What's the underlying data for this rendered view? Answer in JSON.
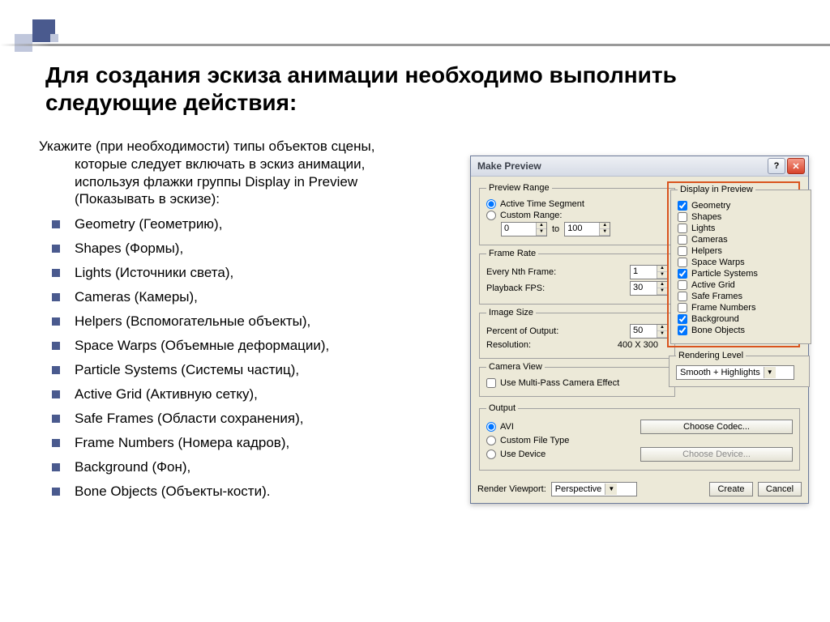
{
  "title": "Для создания эскиза анимации необходимо выполнить следующие действия:",
  "intro": "Укажите (при необходимости) типы объектов сцены, которые следует включать в эскиз анимации, используя флажки группы Display in Preview (Показывать в эскизе):",
  "bullets": [
    "Geometry (Геометрию),",
    " Shapes (Формы),",
    "Lights (Источники света),",
    "Cameras (Камеры),",
    " Helpers (Вспомогательные объекты),",
    "Space Warps (Объемные деформации),",
    " Particle Systems (Системы частиц),",
    "Active Grid (Активную сетку),",
    "Safe Frames (Области сохранения),",
    "Frame Numbers (Номера кадров),",
    " Background (Фон),",
    "Bone Objects (Объекты-кости)."
  ],
  "dialog": {
    "title": "Make Preview",
    "help": "?",
    "close": "✕",
    "previewRange": {
      "legend": "Preview Range",
      "active": "Active Time Segment",
      "custom": "Custom Range:",
      "from": "0",
      "to_label": "to",
      "to": "100"
    },
    "frameRate": {
      "legend": "Frame Rate",
      "every": "Every Nth Frame:",
      "every_val": "1",
      "fps": "Playback FPS:",
      "fps_val": "30"
    },
    "imageSize": {
      "legend": "Image Size",
      "percent": "Percent of Output:",
      "percent_val": "50",
      "res_label": "Resolution:",
      "res_val": "400  X  300"
    },
    "cameraView": {
      "legend": "Camera View",
      "multipass": "Use Multi-Pass Camera Effect"
    },
    "display": {
      "legend": "Display in Preview",
      "items": [
        {
          "label": "Geometry",
          "checked": true
        },
        {
          "label": "Shapes",
          "checked": false
        },
        {
          "label": "Lights",
          "checked": false
        },
        {
          "label": "Cameras",
          "checked": false
        },
        {
          "label": "Helpers",
          "checked": false
        },
        {
          "label": "Space Warps",
          "checked": false
        },
        {
          "label": "Particle Systems",
          "checked": true
        },
        {
          "label": "Active Grid",
          "checked": false
        },
        {
          "label": "Safe Frames",
          "checked": false
        },
        {
          "label": "Frame Numbers",
          "checked": false
        },
        {
          "label": "Background",
          "checked": true
        },
        {
          "label": "Bone Objects",
          "checked": true
        }
      ]
    },
    "renderingLevel": {
      "legend": "Rendering Level",
      "value": "Smooth + Highlights"
    },
    "output": {
      "legend": "Output",
      "avi": "AVI",
      "custom": "Custom File Type",
      "device": "Use Device",
      "codec_btn": "Choose Codec...",
      "device_btn": "Choose Device..."
    },
    "footer": {
      "viewport_label": "Render Viewport:",
      "viewport_val": "Perspective",
      "create": "Create",
      "cancel": "Cancel"
    }
  }
}
